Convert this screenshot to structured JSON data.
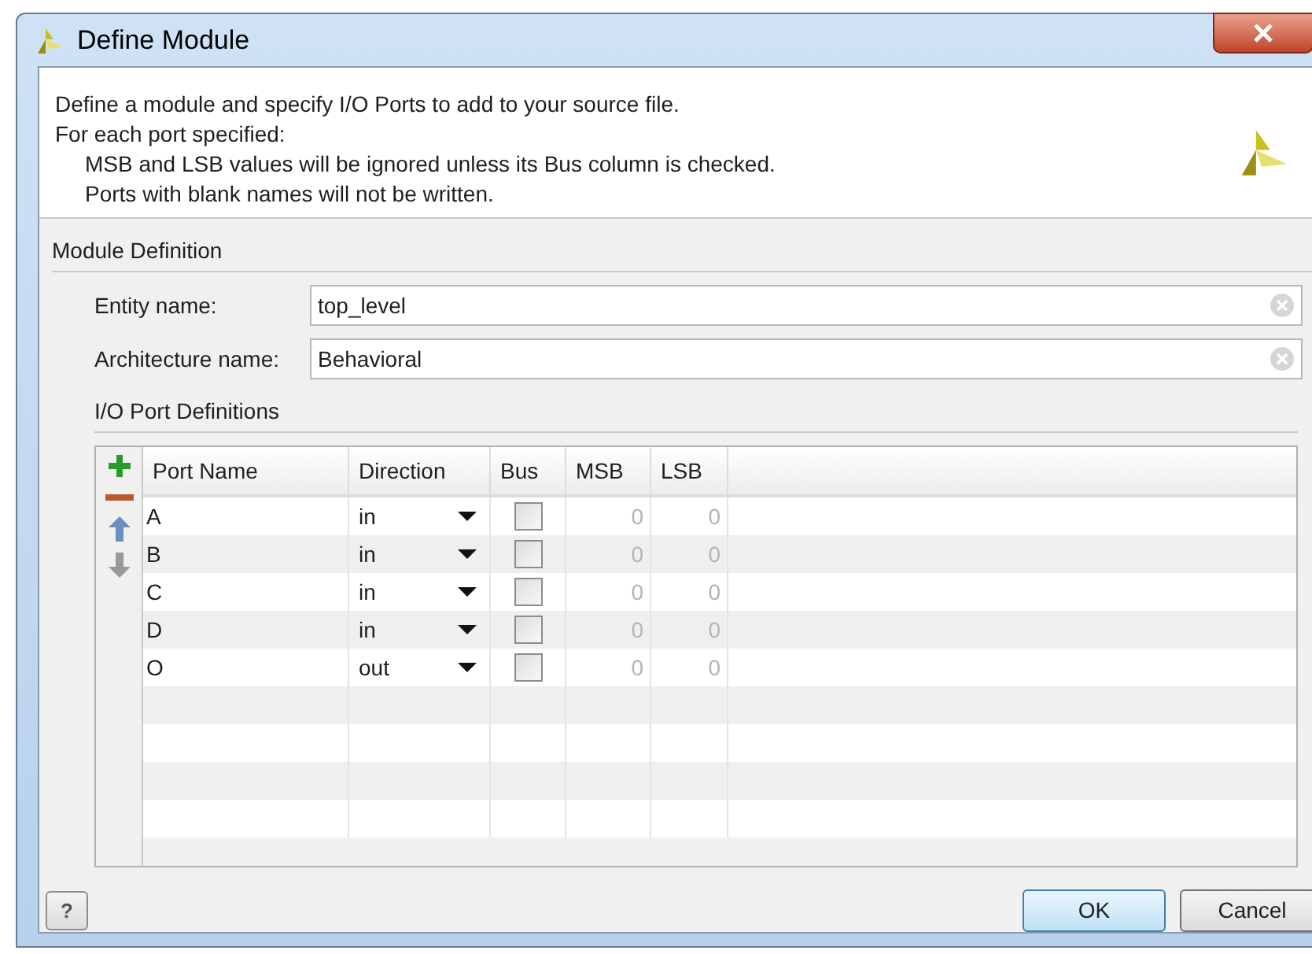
{
  "window": {
    "title": "Define Module"
  },
  "description": {
    "lines": [
      {
        "text": "Define a module and specify I/O Ports to add to your source file.",
        "indent": false
      },
      {
        "text": "For each port specified:",
        "indent": false
      },
      {
        "text": "MSB and LSB values will be ignored unless its Bus column is checked.",
        "indent": true
      },
      {
        "text": "Ports with blank names will not be written.",
        "indent": true
      }
    ]
  },
  "module_definition": {
    "title": "Module Definition",
    "fields": [
      {
        "label": "Entity name:",
        "value": "top_level"
      },
      {
        "label": "Architecture name:",
        "value": "Behavioral"
      }
    ]
  },
  "ports": {
    "title": "I/O Port Definitions",
    "columns": [
      "Port Name",
      "Direction",
      "Bus",
      "MSB",
      "LSB"
    ],
    "rows": [
      {
        "name": "A",
        "direction": "in",
        "bus": false,
        "msb": "0",
        "lsb": "0"
      },
      {
        "name": "B",
        "direction": "in",
        "bus": false,
        "msb": "0",
        "lsb": "0"
      },
      {
        "name": "C",
        "direction": "in",
        "bus": false,
        "msb": "0",
        "lsb": "0"
      },
      {
        "name": "D",
        "direction": "in",
        "bus": false,
        "msb": "0",
        "lsb": "0"
      },
      {
        "name": "O",
        "direction": "out",
        "bus": false,
        "msb": "0",
        "lsb": "0"
      }
    ]
  },
  "buttons": [
    {
      "label": "?",
      "kind": "help"
    },
    {
      "label": "OK",
      "kind": "default"
    },
    {
      "label": "Cancel",
      "kind": "normal"
    }
  ]
}
